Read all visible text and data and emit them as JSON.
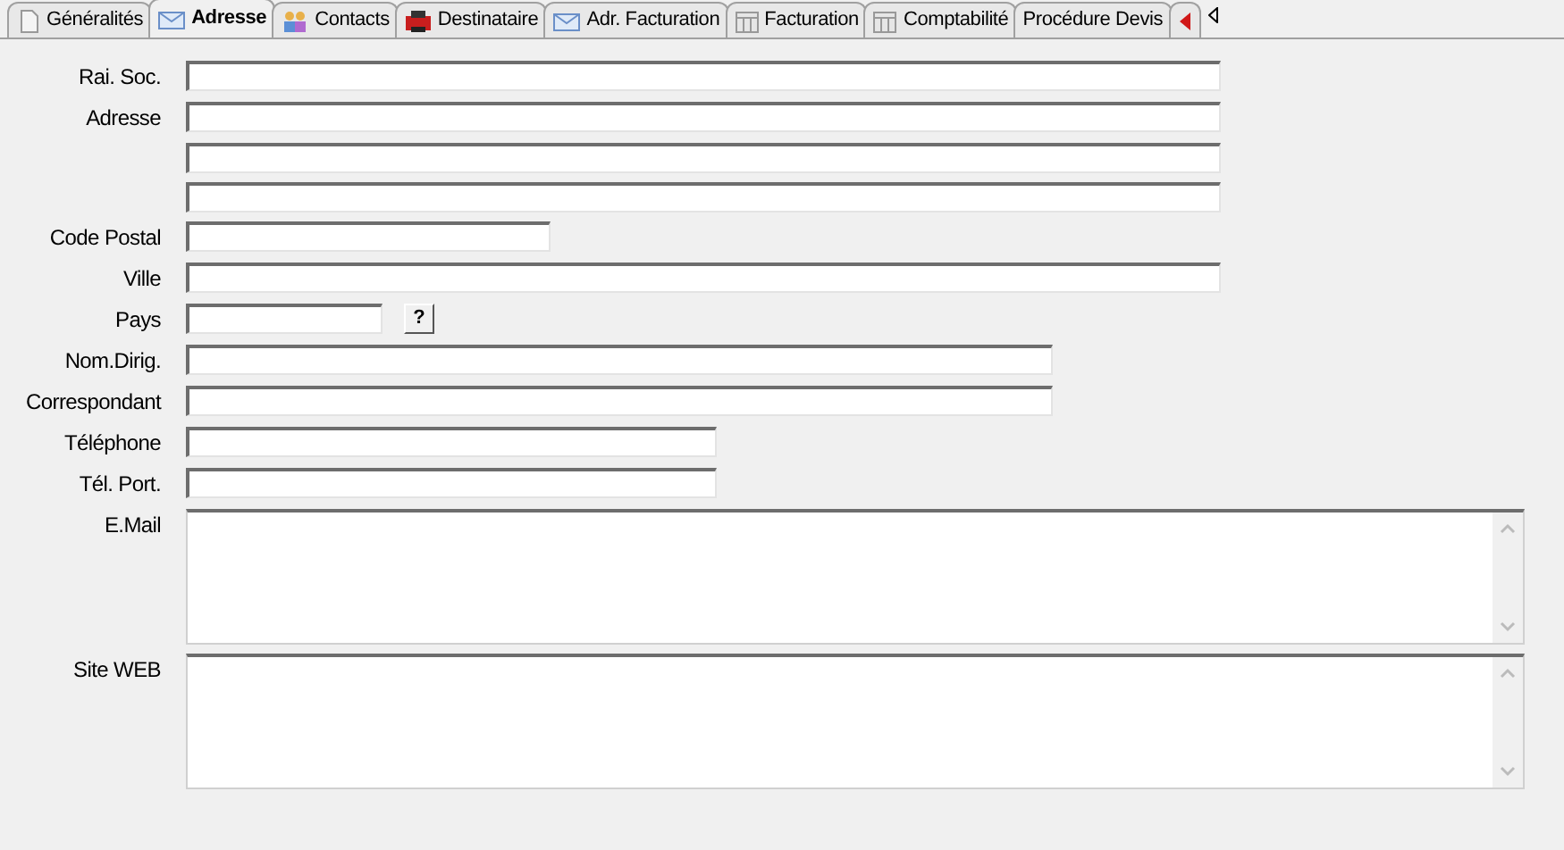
{
  "tabs": [
    {
      "label": "Généralités",
      "selected": false
    },
    {
      "label": "Adresse",
      "selected": true
    },
    {
      "label": "Contacts",
      "selected": false
    },
    {
      "label": "Destinataire",
      "selected": false
    },
    {
      "label": "Adr. Facturation",
      "selected": false
    },
    {
      "label": "Facturation",
      "selected": false
    },
    {
      "label": "Comptabilité",
      "selected": false
    },
    {
      "label": "Procédure Devis",
      "selected": false
    },
    {
      "selected": false
    }
  ],
  "fields": [
    {
      "label": "Rai. Soc.",
      "kind": "full"
    },
    {
      "label": "Adresse",
      "kind": "full"
    },
    {
      "kind": "full"
    },
    {
      "kind": "full"
    },
    {
      "label": "Code Postal",
      "kind": "short"
    },
    {
      "label": "Ville",
      "kind": "full"
    },
    {
      "label": "Pays",
      "kind": "lookup",
      "button": "?"
    },
    {
      "label": "Nom.Dirig.",
      "kind": "large"
    },
    {
      "label": "Correspondant",
      "kind": "large"
    },
    {
      "label": "Téléphone",
      "kind": "medium"
    },
    {
      "label": "Tél. Port.",
      "kind": "medium"
    },
    {
      "label": "E.Mail",
      "kind": "area"
    },
    {
      "label": "Site WEB",
      "kind": "area"
    }
  ]
}
